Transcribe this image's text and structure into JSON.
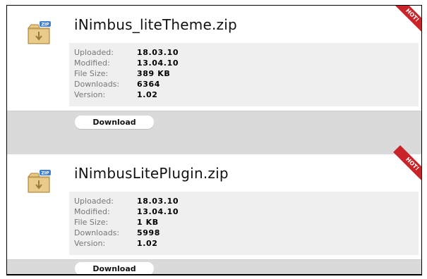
{
  "files": [
    {
      "name": "iNimbus_liteTheme.zip",
      "badge": "HOT!",
      "icon_label": "ZIP",
      "meta": [
        {
          "label": "Uploaded:",
          "value": "18.03.10"
        },
        {
          "label": "Modified:",
          "value": "13.04.10"
        },
        {
          "label": "File Size:",
          "value": "389 KB"
        },
        {
          "label": "Downloads:",
          "value": "6364"
        },
        {
          "label": "Version:",
          "value": "1.02"
        }
      ],
      "download_label": "Download"
    },
    {
      "name": "iNimbusLitePlugin.zip",
      "badge": "HOT!",
      "icon_label": "ZIP",
      "meta": [
        {
          "label": "Uploaded:",
          "value": "18.03.10"
        },
        {
          "label": "Modified:",
          "value": "13.04.10"
        },
        {
          "label": "File Size:",
          "value": "1 KB"
        },
        {
          "label": "Downloads:",
          "value": "5998"
        },
        {
          "label": "Version:",
          "value": "1.02"
        }
      ],
      "download_label": "Download"
    }
  ],
  "colors": {
    "band": "#dadada",
    "meta_bg": "#efefef",
    "hot_ribbon": "#c8242a",
    "zip_tag": "#3d7fd1"
  },
  "icons": [
    "zip-file-icon"
  ]
}
